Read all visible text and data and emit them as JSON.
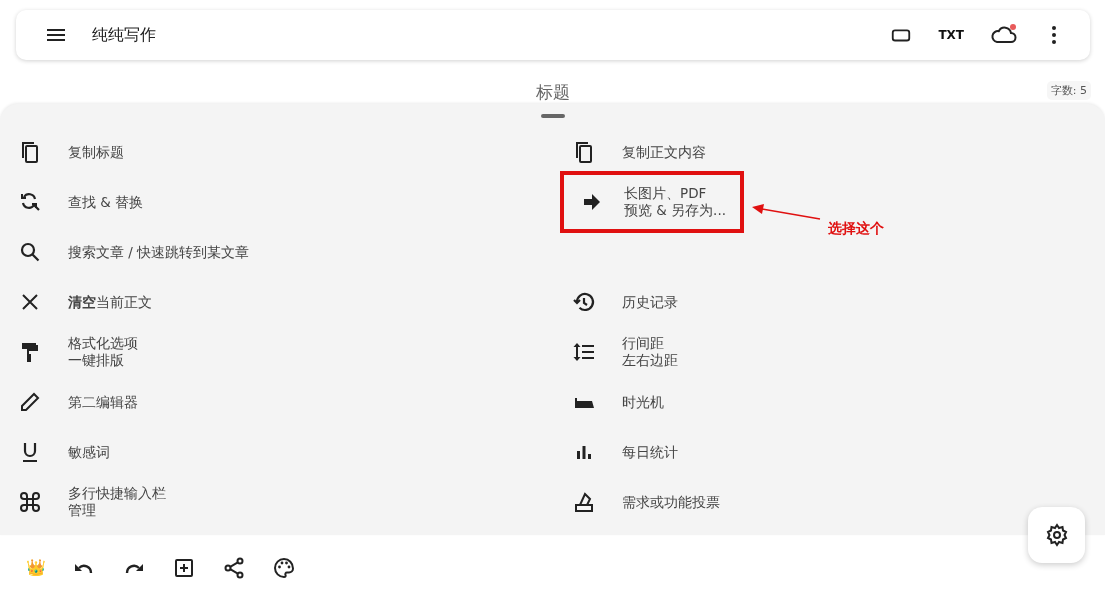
{
  "app_bar": {
    "title": "纯纯写作",
    "txt_label": "TXT",
    "sync_badge": true
  },
  "document": {
    "title": "标题",
    "word_count": "字数: 5"
  },
  "menu": {
    "rows": [
      {
        "left": {
          "lines": [
            "复制标题"
          ]
        },
        "right": {
          "lines": [
            "复制正文内容"
          ],
          "highlighted": false
        }
      },
      {
        "left": {
          "lines": [
            "查找 & 替换"
          ]
        },
        "right": {
          "lines": [
            "长图片、PDF",
            "预览 & 另存为..."
          ],
          "highlighted": true
        }
      },
      {
        "left": {
          "lines": [
            "搜索文章 / 快速跳转到某文章"
          ]
        }
      },
      {
        "left": {
          "lines": [
            "**清空**当前正文"
          ]
        },
        "right": {
          "lines": [
            "历史记录"
          ],
          "highlighted": false
        }
      },
      {
        "left": {
          "lines": [
            "格式化选项",
            "一键排版"
          ]
        },
        "right": {
          "lines": [
            "行间距",
            "左右边距"
          ],
          "highlighted": false
        }
      },
      {
        "left": {
          "lines": [
            "第二编辑器"
          ]
        },
        "right": {
          "lines": [
            "时光机"
          ],
          "highlighted": false
        }
      },
      {
        "left": {
          "lines": [
            "敏感词"
          ]
        },
        "right": {
          "lines": [
            "每日统计"
          ],
          "highlighted": false
        }
      },
      {
        "left": {
          "lines": [
            "多行快捷输入栏",
            "管理"
          ]
        },
        "right": {
          "lines": [
            "需求或功能投票"
          ],
          "highlighted": false
        }
      }
    ]
  },
  "annotation": {
    "text": "选择这个"
  },
  "bottom_bar": {
    "crown": "👑"
  }
}
